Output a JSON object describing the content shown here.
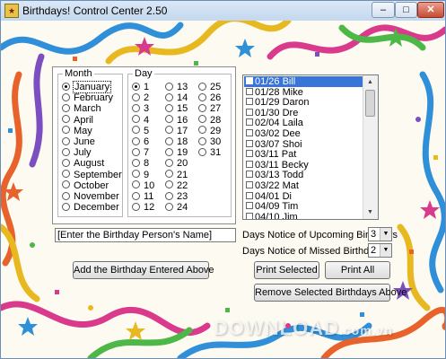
{
  "window": {
    "title": "Birthdays! Control Center 2.50",
    "minimize_glyph": "–",
    "maximize_glyph": "□",
    "close_glyph": "✕"
  },
  "month_group": {
    "title": "Month",
    "selected": "January",
    "options": [
      "January",
      "February",
      "March",
      "April",
      "May",
      "June",
      "July",
      "August",
      "September",
      "October",
      "November",
      "December"
    ]
  },
  "day_group": {
    "title": "Day",
    "selected": "1",
    "options": [
      "1",
      "2",
      "3",
      "4",
      "5",
      "6",
      "7",
      "8",
      "9",
      "10",
      "11",
      "12",
      "13",
      "14",
      "15",
      "16",
      "17",
      "18",
      "19",
      "20",
      "21",
      "22",
      "23",
      "24",
      "25",
      "26",
      "27",
      "28",
      "29",
      "30",
      "31"
    ]
  },
  "birthday_list": {
    "selected_index": 0,
    "items": [
      "01/26 Bill",
      "01/28 Mike",
      "01/29 Daron",
      "01/30 Dre",
      "02/04 Laila",
      "03/02 Dee",
      "03/07 Shoi",
      "03/11 Pat",
      "03/11 Becky",
      "03/13 Todd",
      "03/22 Mat",
      "04/01 Di",
      "04/09 Tim",
      "04/10 Jim"
    ]
  },
  "name_input": {
    "value": "[Enter the Birthday Person's Name]"
  },
  "upcoming_notice": {
    "label": "Days Notice of Upcoming Birthdays",
    "value": "3"
  },
  "missed_notice": {
    "label": "Days Notice of Missed Birthdays",
    "value": "2"
  },
  "buttons": {
    "add": "Add the Birthday Entered Above",
    "print_selected": "Print Selected",
    "print_all": "Print All",
    "remove_selected": "Remove Selected Birthdays Above"
  },
  "watermark": {
    "text": "DOWNLOAD",
    "suffix": ".com.vn"
  },
  "colors": {
    "accent": "#3875d7",
    "title_bar": "#c3d7ee",
    "close": "#c74b33"
  }
}
